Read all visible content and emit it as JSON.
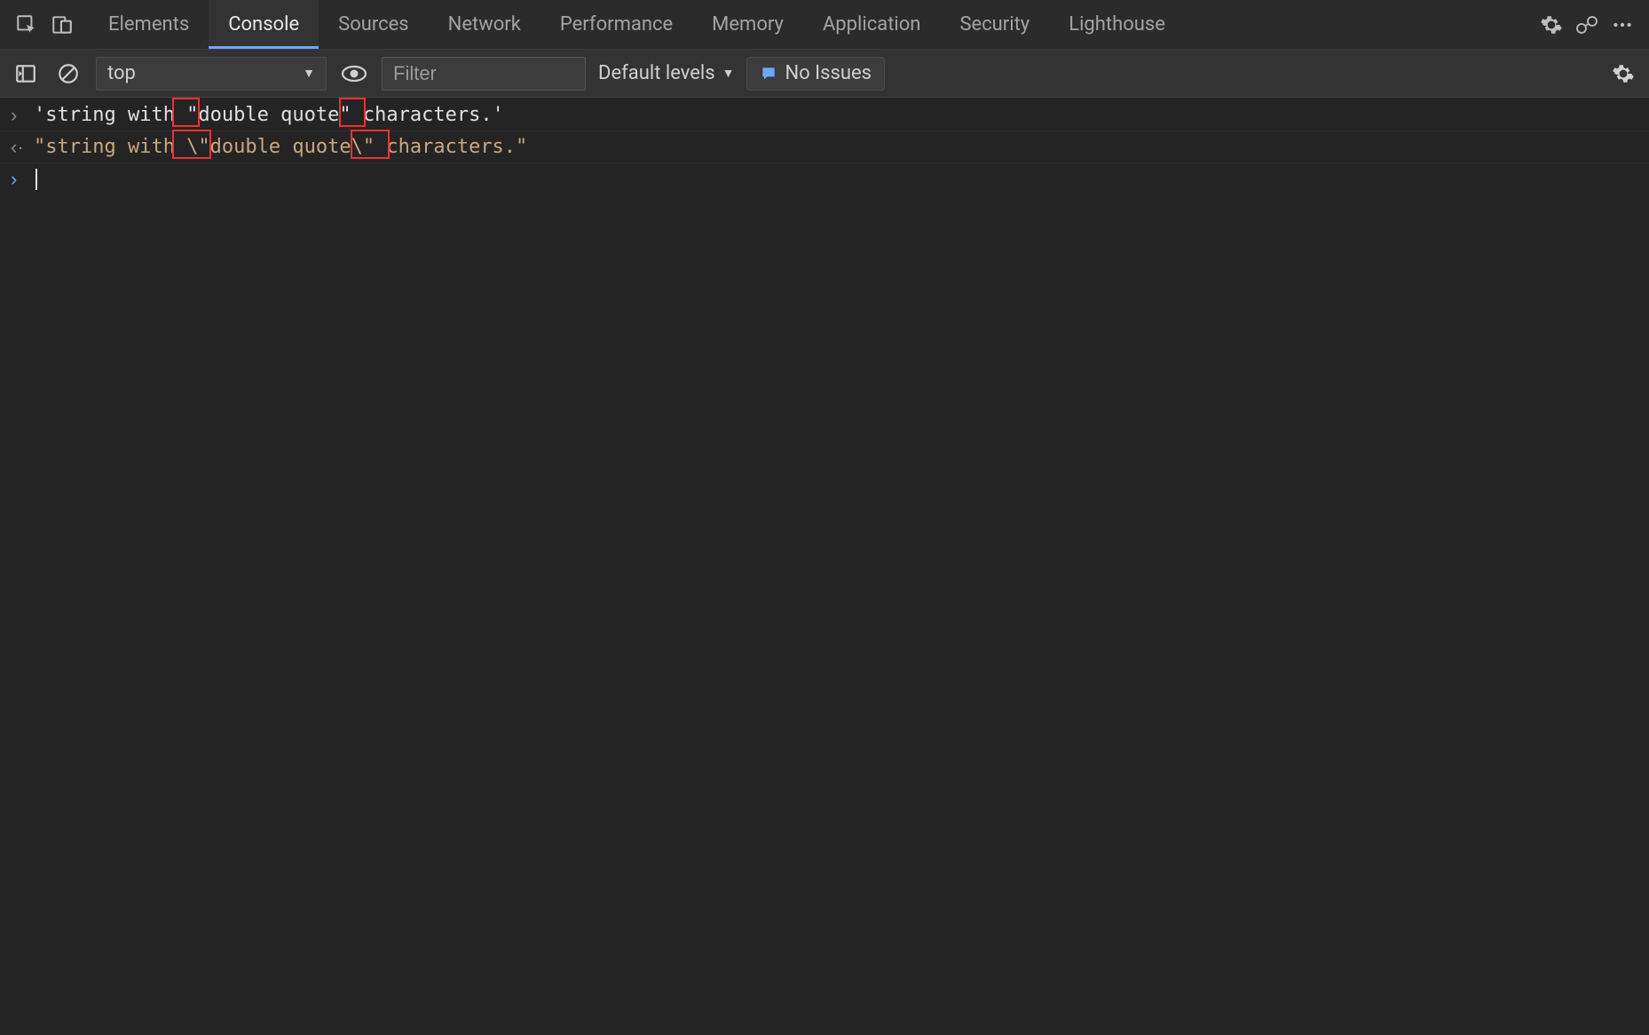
{
  "tabs": {
    "elements": "Elements",
    "console": "Console",
    "sources": "Sources",
    "network": "Network",
    "performance": "Performance",
    "memory": "Memory",
    "application": "Application",
    "security": "Security",
    "lighthouse": "Lighthouse",
    "active": "console"
  },
  "toolbar": {
    "context": "top",
    "filter_placeholder": "Filter",
    "levels_label": "Default levels",
    "issues_label": "No Issues"
  },
  "console": {
    "lines": [
      {
        "kind": "input",
        "text": "'string with \"double quote\" characters.'"
      },
      {
        "kind": "output",
        "text": "\"string with \\\"double quote\\\" characters.\""
      }
    ],
    "highlights": [
      {
        "line": 0,
        "left_ch": 12.0,
        "width_ch": 2.0
      },
      {
        "line": 0,
        "left_ch": 26.2,
        "width_ch": 2.0
      },
      {
        "line": 1,
        "left_ch": 12.0,
        "width_ch": 3.0
      },
      {
        "line": 1,
        "left_ch": 27.2,
        "width_ch": 3.0
      }
    ]
  }
}
